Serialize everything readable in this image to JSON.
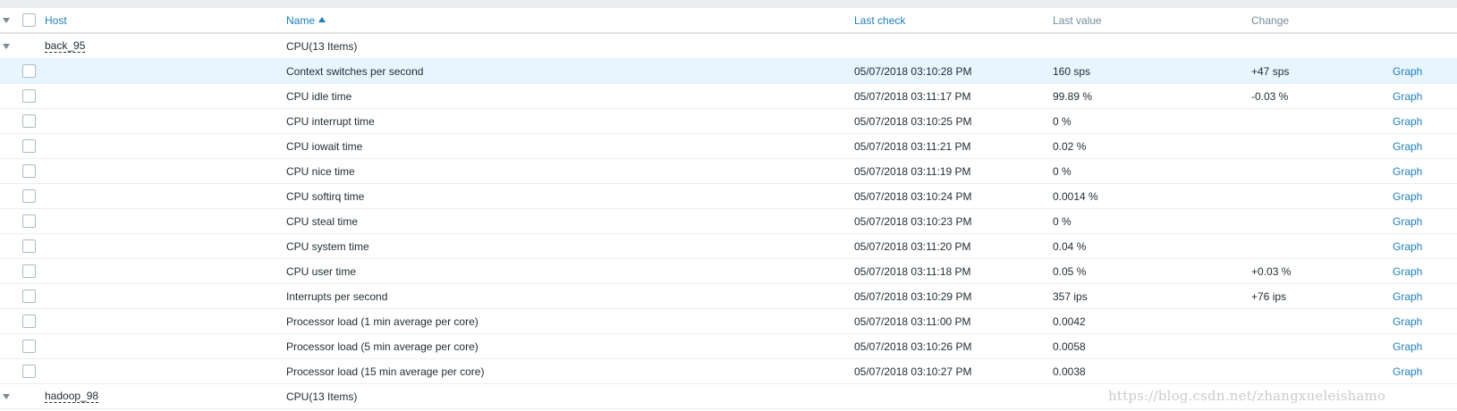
{
  "header": {
    "host": "Host",
    "name": "Name",
    "last_check": "Last check",
    "last_value": "Last value",
    "change": "Change"
  },
  "groups": [
    {
      "host": "back_95",
      "app": "CPU",
      "count": "(13 Items)",
      "items": [
        {
          "name": "Context switches per second",
          "last_check": "05/07/2018 03:10:28 PM",
          "last_value": "160 sps",
          "change": "+47 sps",
          "action": "Graph"
        },
        {
          "name": "CPU idle time",
          "last_check": "05/07/2018 03:11:17 PM",
          "last_value": "99.89 %",
          "change": "-0.03 %",
          "action": "Graph"
        },
        {
          "name": "CPU interrupt time",
          "last_check": "05/07/2018 03:10:25 PM",
          "last_value": "0 %",
          "change": "",
          "action": "Graph"
        },
        {
          "name": "CPU iowait time",
          "last_check": "05/07/2018 03:11:21 PM",
          "last_value": "0.02 %",
          "change": "",
          "action": "Graph"
        },
        {
          "name": "CPU nice time",
          "last_check": "05/07/2018 03:11:19 PM",
          "last_value": "0 %",
          "change": "",
          "action": "Graph"
        },
        {
          "name": "CPU softirq time",
          "last_check": "05/07/2018 03:10:24 PM",
          "last_value": "0.0014 %",
          "change": "",
          "action": "Graph"
        },
        {
          "name": "CPU steal time",
          "last_check": "05/07/2018 03:10:23 PM",
          "last_value": "0 %",
          "change": "",
          "action": "Graph"
        },
        {
          "name": "CPU system time",
          "last_check": "05/07/2018 03:11:20 PM",
          "last_value": "0.04 %",
          "change": "",
          "action": "Graph"
        },
        {
          "name": "CPU user time",
          "last_check": "05/07/2018 03:11:18 PM",
          "last_value": "0.05 %",
          "change": "+0.03 %",
          "action": "Graph"
        },
        {
          "name": "Interrupts per second",
          "last_check": "05/07/2018 03:10:29 PM",
          "last_value": "357 ips",
          "change": "+76 ips",
          "action": "Graph"
        },
        {
          "name": "Processor load (1 min average per core)",
          "last_check": "05/07/2018 03:11:00 PM",
          "last_value": "0.0042",
          "change": "",
          "action": "Graph"
        },
        {
          "name": "Processor load (5 min average per core)",
          "last_check": "05/07/2018 03:10:26 PM",
          "last_value": "0.0058",
          "change": "",
          "action": "Graph"
        },
        {
          "name": "Processor load (15 min average per core)",
          "last_check": "05/07/2018 03:10:27 PM",
          "last_value": "0.0038",
          "change": "",
          "action": "Graph"
        }
      ]
    },
    {
      "host": "hadoop_98",
      "app": "CPU",
      "count": "(13 Items)",
      "items": []
    }
  ],
  "watermark": "https://blog.csdn.net/zhangxueleishamo",
  "colors": {
    "link": "#1f7fbb",
    "highlight_row": "#e8f5ff",
    "header_band": "#ebeef0"
  }
}
